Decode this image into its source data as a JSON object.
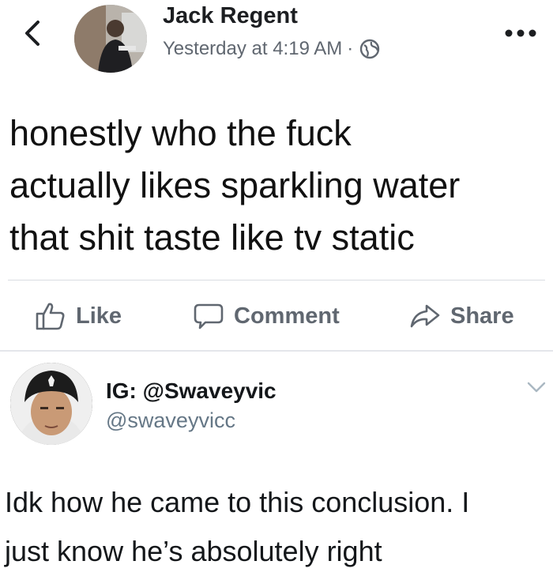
{
  "post": {
    "author": "Jack Regent",
    "timestamp": "Yesterday at 4:19 AM",
    "separator": "·",
    "privacy_icon": "globe-icon",
    "text": "honestly who the fuck\nactually likes sparkling water\nthat shit taste like tv static",
    "actions": {
      "like": "Like",
      "comment": "Comment",
      "share": "Share"
    }
  },
  "reply": {
    "name": "IG: @Swaveyvic",
    "handle": "@swaveyvicc",
    "text": "Idk how he came to this conclusion. I\njust know he’s absolutely right"
  },
  "colors": {
    "text_primary": "#1c1e21",
    "text_secondary": "#606770",
    "handle_gray": "#657786",
    "divider": "#dadde1"
  }
}
